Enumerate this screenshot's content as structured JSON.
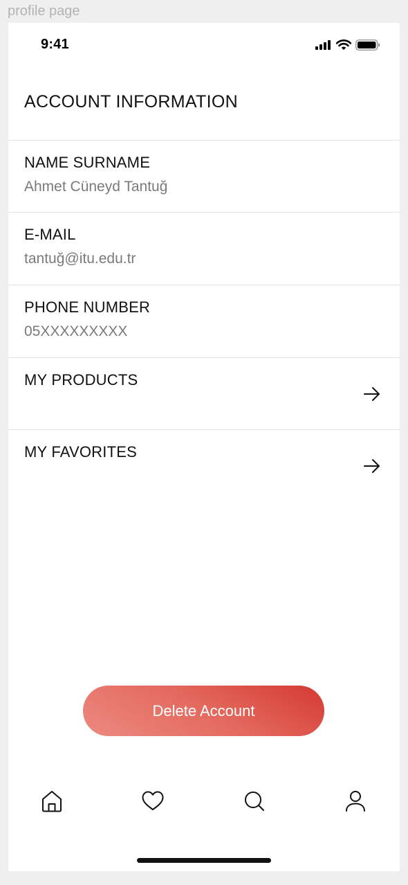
{
  "frame_label": "profile page",
  "status_bar": {
    "time": "9:41"
  },
  "page": {
    "title": "ACCOUNT INFORMATION"
  },
  "fields": [
    {
      "label": "NAME SURNAME",
      "value": "Ahmet Cüneyd Tantuğ"
    },
    {
      "label": "E-MAIL",
      "value": "tantuğ@itu.edu.tr"
    },
    {
      "label": "PHONE NUMBER",
      "value": "05XXXXXXXXX"
    }
  ],
  "links": [
    {
      "label": "MY PRODUCTS",
      "icon": "arrow-right-icon"
    },
    {
      "label": "MY FAVORITES",
      "icon": "arrow-right-icon"
    }
  ],
  "delete_button": {
    "label": "Delete Account",
    "colors": [
      "#ec8a80",
      "#d43a32"
    ]
  },
  "tab_bar": {
    "items": [
      {
        "icon": "home-icon"
      },
      {
        "icon": "heart-icon"
      },
      {
        "icon": "search-icon"
      },
      {
        "icon": "profile-icon"
      }
    ]
  }
}
